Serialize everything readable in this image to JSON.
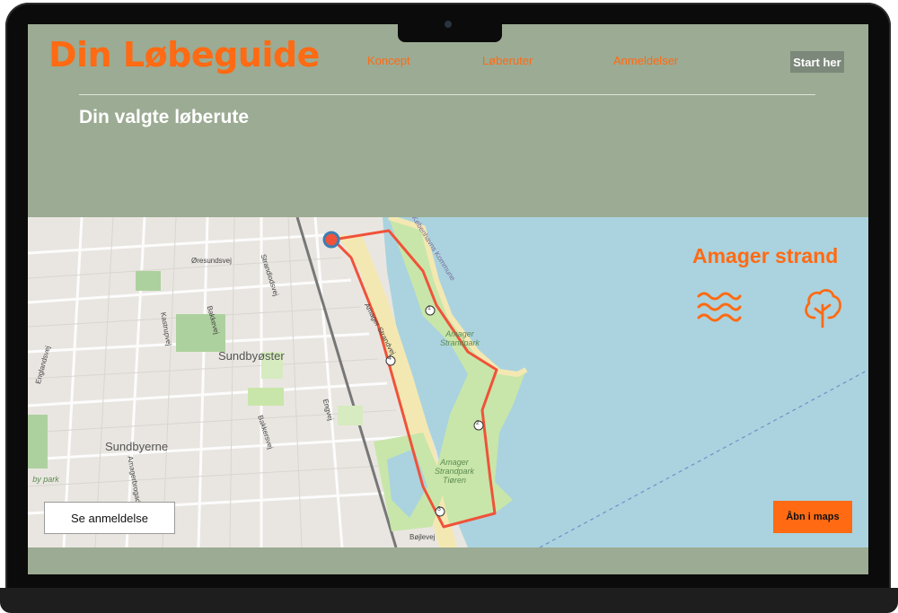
{
  "header": {
    "logo": "Din Løbeguide",
    "nav": [
      "Koncept",
      "Løberuter",
      "Anmeldelser"
    ],
    "cta": "Start her"
  },
  "page": {
    "title": "Din valgte løberute"
  },
  "route": {
    "name": "Amager strand",
    "icons": [
      "waves-icon",
      "tree-icon"
    ],
    "review_button": "Se anmeldelse",
    "maps_button": "Åbn i maps"
  },
  "map": {
    "districts": [
      "Sundbyøster",
      "Sundbyerne"
    ],
    "park_labels": [
      "Amager Strandpark",
      "Amager Strandpark Tiøren"
    ],
    "park_label_partial": "by park",
    "municipality": "Københavns Kommune",
    "streets": [
      "Øresundsvej",
      "Amager Strandvej",
      "Kastrupvej",
      "Bakkevej",
      "Strandlodsvej",
      "Engvej",
      "Bakkersvej",
      "Englandsvej",
      "Amagerbrogade",
      "Bøjlevej"
    ],
    "markers": [
      "1",
      "2",
      "3",
      "4"
    ],
    "colors": {
      "route": "#f0523a",
      "water": "#aad3df",
      "land": "#ece9e4",
      "park": "#c8e6a9",
      "beach": "#f4e8b2",
      "accent": "#ff6a13"
    }
  }
}
